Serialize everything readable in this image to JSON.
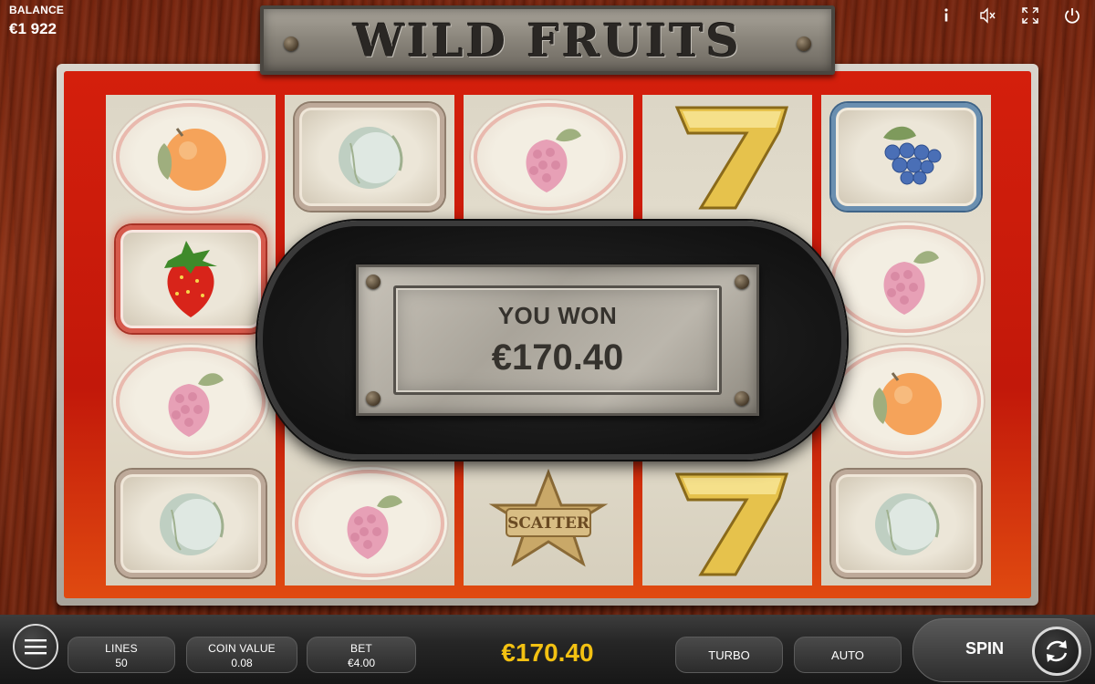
{
  "balance": {
    "label": "BALANCE",
    "value": "€1 922"
  },
  "top_icons": [
    "info-icon",
    "mute-icon",
    "fullscreen-icon",
    "power-icon"
  ],
  "title": "WILD FRUITS",
  "reels": [
    [
      "orange",
      "strawberry",
      "raspberry",
      "melon"
    ],
    [
      "melon",
      "hidden",
      "hidden",
      "raspberry"
    ],
    [
      "raspberry",
      "hidden",
      "hidden",
      "scatter"
    ],
    [
      "seven",
      "hidden",
      "hidden",
      "seven"
    ],
    [
      "grapes",
      "raspberry",
      "orange",
      "melon"
    ]
  ],
  "scatter_label": "SCATTER",
  "popup": {
    "title": "YOU WON",
    "amount": "€170.40"
  },
  "bottom": {
    "lines": {
      "label": "LINES",
      "value": "50"
    },
    "coin_value": {
      "label": "COIN VALUE",
      "value": "0.08"
    },
    "bet": {
      "label": "BET",
      "value": "€4.00"
    },
    "win": "€170.40",
    "turbo": "TURBO",
    "auto": "AUTO",
    "spin": "SPIN"
  },
  "colors": {
    "frame_red": "#d41f0c",
    "win_gold": "#f3c112",
    "wood": "#7a2710"
  }
}
